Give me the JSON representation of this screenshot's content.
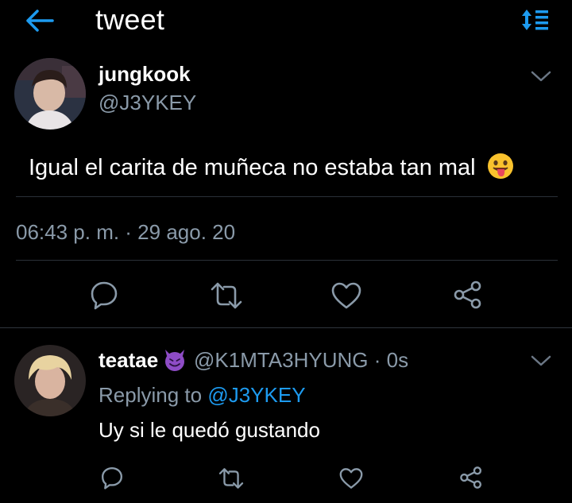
{
  "header": {
    "title": "tweet",
    "back_icon": "arrow-left-icon",
    "sort_icon": "sort-icon"
  },
  "tweet": {
    "name": "jungkook",
    "handle": "@J3YKEY",
    "text": "Igual el carita de muñeca no estaba tan mal",
    "emoji": "tongue-out-emoji",
    "timestamp": "06:43 p. m. · 29 ago. 20"
  },
  "reply": {
    "name": "teatae",
    "emoji": "smiling-devil-emoji",
    "handle_time": "@K1MTA3HYUNG · 0s",
    "replying_prefix": "Replying to ",
    "replying_mention": "@J3YKEY",
    "text": "Uy si le quedó gustando"
  },
  "colors": {
    "background": "#000000",
    "accent": "#1d9bf0",
    "muted": "#8a9aa9",
    "divider": "#2a3038"
  }
}
